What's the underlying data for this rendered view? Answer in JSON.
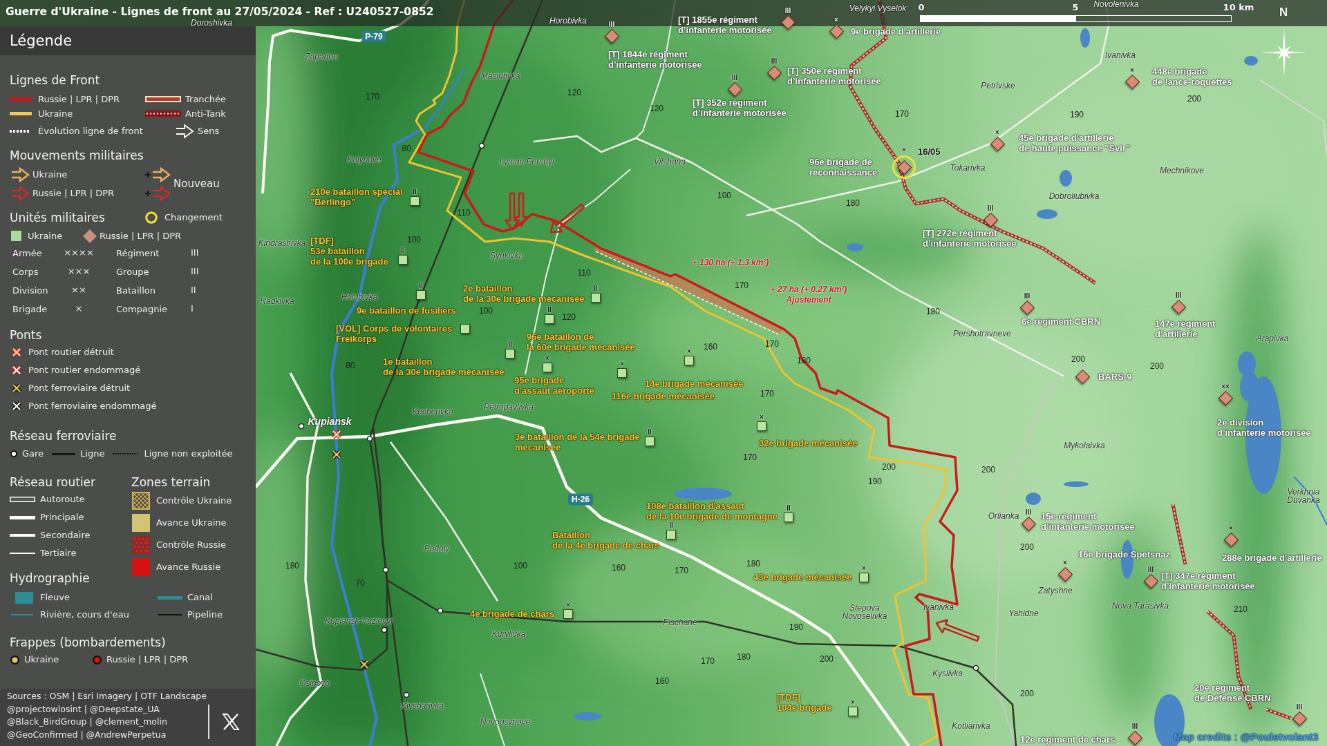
{
  "title": "Guerre d'Ukraine - Lignes de front au 27/05/2024 - Ref : U240527-0852",
  "scale_bar": {
    "labels": [
      "0",
      "5",
      "10 km"
    ]
  },
  "north_label": "N",
  "legend": {
    "title": "Légende",
    "front_lines": {
      "heading": "Lignes de Front",
      "items": [
        {
          "kind": "russia",
          "label": "Russie | LPR | DPR"
        },
        {
          "kind": "ukraine",
          "label": "Ukraine"
        },
        {
          "kind": "evolution",
          "label": "Évolution ligne de front"
        },
        {
          "kind": "trench",
          "label": "Tranchée"
        },
        {
          "kind": "antitank",
          "label": "Anti-Tank"
        },
        {
          "kind": "direction",
          "label": "Sens"
        }
      ]
    },
    "movements": {
      "heading": "Mouvements militaires",
      "items": [
        {
          "kind": "ukraine",
          "label": "Ukraine"
        },
        {
          "kind": "russia",
          "label": "Russie | LPR | DPR"
        }
      ],
      "new_label": "Nouveau"
    },
    "units": {
      "heading": "Unités militaires",
      "change_label": "Changement",
      "sides": [
        {
          "kind": "ukraine",
          "label": "Ukraine"
        },
        {
          "kind": "russia",
          "label": "Russie | LPR | DPR"
        }
      ],
      "echelons": [
        {
          "name": "Armée",
          "symbol": "××××"
        },
        {
          "name": "Corps",
          "symbol": "×××"
        },
        {
          "name": "Division",
          "symbol": "××"
        },
        {
          "name": "Brigade",
          "symbol": "×"
        },
        {
          "name": "Régiment",
          "symbol": "III"
        },
        {
          "name": "Groupe",
          "symbol": "III"
        },
        {
          "name": "Bataillon",
          "symbol": "II"
        },
        {
          "name": "Compagnie",
          "symbol": "I"
        }
      ]
    },
    "bridges": {
      "heading": "Ponts",
      "items": [
        {
          "kind": "road_destroyed",
          "label": "Pont routier détruit"
        },
        {
          "kind": "road_damaged",
          "label": "Pont routier endommagé"
        },
        {
          "kind": "rail_destroyed",
          "label": "Pont ferroviaire détruit"
        },
        {
          "kind": "rail_damaged",
          "label": "Pont ferroviaire endommagé"
        }
      ]
    },
    "railway": {
      "heading": "Réseau ferroviaire",
      "items": [
        {
          "kind": "station",
          "label": "Gare"
        },
        {
          "kind": "line",
          "label": "Ligne"
        },
        {
          "kind": "unused",
          "label": "Ligne non exploitée"
        }
      ]
    },
    "roads": {
      "heading": "Réseau routier",
      "items": [
        {
          "kind": "motorway",
          "label": "Autoroute"
        },
        {
          "kind": "primary",
          "label": "Principale"
        },
        {
          "kind": "secondary",
          "label": "Secondaire"
        },
        {
          "kind": "tertiary",
          "label": "Tertiaire"
        }
      ]
    },
    "terrain": {
      "heading": "Zones terrain",
      "items": [
        {
          "kind": "ukraine_control",
          "label": "Contrôle Ukraine"
        },
        {
          "kind": "ukraine_advance",
          "label": "Avance Ukraine"
        },
        {
          "kind": "russia_control",
          "label": "Contrôle Russie"
        },
        {
          "kind": "russia_advance",
          "label": "Avance Russie"
        }
      ]
    },
    "hydrography": {
      "heading": "Hydrographie",
      "items": [
        {
          "kind": "river",
          "label": "Fleuve"
        },
        {
          "kind": "canal",
          "label": "Canal"
        },
        {
          "kind": "stream",
          "label": "Rivière, cours d'eau"
        },
        {
          "kind": "pipeline",
          "label": "Pipeline"
        }
      ]
    },
    "strikes": {
      "heading": "Frappes (bombardements)",
      "items": [
        {
          "kind": "ukraine",
          "label": "Ukraine"
        },
        {
          "kind": "russia",
          "label": "Russie | LPR | DPR"
        }
      ]
    },
    "sources": "Sources : OSM | Esri Imagery | OTF Landscape",
    "contributors": [
      "@projectowlosint | @Deepstate_UA",
      "@Black_BirdGroup | @clement_molin",
      "@GeoConfirmed | @AndrewPerpetua"
    ]
  },
  "map": {
    "road_numbers": [
      "P-79",
      "H-26"
    ],
    "places": [
      {
        "name": "Velykyi Vyselok",
        "kind": "village"
      },
      {
        "name": "Novolenivka",
        "kind": "village"
      },
      {
        "name": "Doroshivka",
        "kind": "village"
      },
      {
        "name": "Horobivka",
        "kind": "village"
      },
      {
        "name": "Zapadne",
        "kind": "village"
      },
      {
        "name": "Ivanivka",
        "kind": "village"
      },
      {
        "name": "Masiutivka",
        "kind": "village"
      },
      {
        "name": "Petrivske",
        "kind": "village"
      },
      {
        "name": "Kalynove",
        "kind": "village"
      },
      {
        "name": "Lyman Pershyi",
        "kind": "village"
      },
      {
        "name": "Vilshana",
        "kind": "village"
      },
      {
        "name": "Tokarivka",
        "kind": "village"
      },
      {
        "name": "Mechnikove",
        "kind": "village"
      },
      {
        "name": "Dobroliubivka",
        "kind": "village"
      },
      {
        "name": "Kindrashivka",
        "kind": "village"
      },
      {
        "name": "Synkivka",
        "kind": "village"
      },
      {
        "name": "Radkivka",
        "kind": "village"
      },
      {
        "name": "Holubivka",
        "kind": "village"
      },
      {
        "name": "Pershotravneve",
        "kind": "village"
      },
      {
        "name": "Arapivka",
        "kind": "village"
      },
      {
        "name": "Kucherivka",
        "kind": "village"
      },
      {
        "name": "Petropavlivka",
        "kind": "village"
      },
      {
        "name": "Kupiansk",
        "kind": "city"
      },
      {
        "name": "Mykolaivka",
        "kind": "village"
      },
      {
        "lines": [
          "Verkhnia",
          "Duvanka"
        ],
        "kind": "village"
      },
      {
        "name": "Orlianka",
        "kind": "village"
      },
      {
        "name": "Podoly",
        "kind": "village"
      },
      {
        "name": "Zatyshne",
        "kind": "village"
      },
      {
        "name": "Kupiansk-Vuzlovyi",
        "kind": "village"
      },
      {
        "name": "Pischane",
        "kind": "village"
      },
      {
        "lines": [
          "Stepova",
          "Novoselivka"
        ],
        "kind": "village"
      },
      {
        "name": "Ivanivka",
        "kind": "village"
      },
      {
        "name": "Yahidne",
        "kind": "village"
      },
      {
        "name": "Nova Tarasivka",
        "kind": "village"
      },
      {
        "name": "Kurylivka",
        "kind": "village"
      },
      {
        "name": "Kyslivka",
        "kind": "village"
      },
      {
        "name": "Osinovo",
        "kind": "village"
      },
      {
        "name": "Kivsharivka",
        "kind": "village"
      },
      {
        "name": "Novoosynove",
        "kind": "village"
      },
      {
        "name": "Kotliarivka",
        "kind": "village"
      }
    ],
    "elevations": [
      "170",
      "120",
      "200",
      "120",
      "170",
      "190",
      "80",
      "100",
      "180",
      "110",
      "100",
      "110",
      "170",
      "100",
      "120",
      "180",
      "160",
      "170",
      "80",
      "180",
      "200",
      "200",
      "170",
      "170",
      "200",
      "200",
      "190",
      "200",
      "180",
      "100",
      "160",
      "170",
      "180",
      "70",
      "210",
      "190",
      "170",
      "180",
      "200",
      "160",
      "200"
    ],
    "units": [
      {
        "kind": "russia",
        "echelon": "III",
        "lines": [
          "[T] 1855e régiment",
          "d’infanterie motorisée"
        ],
        "changed": false
      },
      {
        "kind": "russia",
        "echelon": "×",
        "lines": [
          "9e brigade d'artillerie"
        ],
        "changed": false
      },
      {
        "kind": "russia",
        "echelon": "III",
        "lines": [
          "[T] 1844e régiment",
          "d’infanterie motorisée"
        ],
        "changed": false
      },
      {
        "kind": "russia",
        "echelon": "III",
        "lines": [
          "[T] 350e régiment",
          "d’infanterie motorisée"
        ],
        "changed": false
      },
      {
        "kind": "russia",
        "echelon": "×",
        "lines": [
          "448e brigade",
          "de lance-roquettes"
        ],
        "changed": false
      },
      {
        "kind": "russia",
        "echelon": "III",
        "lines": [
          "[T] 352e régiment",
          "d’infanterie motorisée"
        ],
        "changed": false
      },
      {
        "kind": "russia",
        "echelon": "×",
        "lines": [
          "45e brigade d'artillerie",
          "de haute puissance \"Svir\""
        ],
        "changed": false
      },
      {
        "kind": "russia",
        "echelon": "×",
        "lines": [
          "96e brigade de",
          "reconnaissance"
        ],
        "changed": true,
        "date": "16/05"
      },
      {
        "kind": "ukraine",
        "echelon": "II",
        "lines": [
          "210e bataillon spécial",
          "\"Berlingo\""
        ],
        "changed": false
      },
      {
        "kind": "ukraine",
        "echelon": "II",
        "lines": [
          "[TDF]",
          "53e bataillon",
          "de la 100e brigade"
        ],
        "changed": false
      },
      {
        "kind": "russia",
        "echelon": "III",
        "lines": [
          "[T] 272e régiment",
          "d’infanterie motorisée"
        ],
        "changed": false
      },
      {
        "kind": "ukraine",
        "echelon": "II",
        "lines": [
          "9e bataillon de fusiliers"
        ],
        "changed": false
      },
      {
        "kind": "ukraine",
        "echelon": "II",
        "lines": [
          "2e bataillon",
          "de la 30e brigade mécanisée"
        ],
        "changed": false
      },
      {
        "kind": "ukraine",
        "lines": [
          "[VOL] Corps de volontaires",
          "Freikorps"
        ],
        "changed": false
      },
      {
        "kind": "ukraine",
        "echelon": "II",
        "lines": [
          "96e bataillon de",
          "la 60e brigade mécanisée"
        ],
        "changed": false
      },
      {
        "kind": "russia",
        "echelon": "III",
        "lines": [
          "6e régiment CBRN"
        ],
        "changed": false
      },
      {
        "kind": "russia",
        "echelon": "III",
        "lines": [
          "147e régiment",
          "d'artillerie"
        ],
        "changed": false
      },
      {
        "kind": "ukraine",
        "echelon": "II",
        "lines": [
          "1e bataillon",
          "de la 30e brigade mécanisée"
        ],
        "changed": false
      },
      {
        "kind": "ukraine",
        "echelon": "×",
        "lines": [
          "95e brigade",
          "d'assaut aéroporté"
        ],
        "changed": false
      },
      {
        "kind": "ukraine",
        "echelon": "×",
        "lines": [
          "14e brigade mécanisée"
        ],
        "changed": false
      },
      {
        "kind": "russia",
        "lines": [
          "BARS-9"
        ],
        "changed": false
      },
      {
        "kind": "ukraine",
        "echelon": "×",
        "lines": [
          "116e brigade mécanisée"
        ],
        "changed": false
      },
      {
        "kind": "ukraine",
        "echelon": "II",
        "lines": [
          "3e bataillon de la 54e brigade",
          "mécanisée"
        ],
        "changed": false
      },
      {
        "kind": "ukraine",
        "echelon": "×",
        "lines": [
          "32e brigade mécanisée"
        ],
        "changed": false
      },
      {
        "kind": "russia",
        "echelon": "××",
        "lines": [
          "2e division",
          "d’infanterie motorisée"
        ],
        "changed": false
      },
      {
        "kind": "ukraine",
        "echelon": "II",
        "lines": [
          "108e bataillon d'assaut",
          "de la 10e brigade de montagne"
        ],
        "changed": false
      },
      {
        "kind": "ukraine",
        "echelon": "II",
        "lines": [
          "Bataillon",
          "de la 4e brigade de chars"
        ],
        "changed": false
      },
      {
        "kind": "russia",
        "echelon": "III",
        "lines": [
          "15e régiment",
          "d’infanterie motorisée"
        ],
        "changed": false
      },
      {
        "kind": "russia",
        "echelon": "×",
        "lines": [
          "16e brigade Spetsnaz"
        ],
        "changed": false
      },
      {
        "kind": "russia",
        "echelon": "×",
        "lines": [
          "288e brigade d'artillerie"
        ],
        "changed": false
      },
      {
        "kind": "ukraine",
        "echelon": "×",
        "lines": [
          "43e brigade mécanisée"
        ],
        "changed": false
      },
      {
        "kind": "russia",
        "echelon": "III",
        "lines": [
          "[T] 347e régiment",
          "d’infanterie motorisée"
        ],
        "changed": false
      },
      {
        "kind": "ukraine",
        "echelon": "×",
        "lines": [
          "4e brigade de chars"
        ],
        "changed": false
      },
      {
        "kind": "ukraine",
        "echelon": "×",
        "lines": [
          "[TDF]",
          "104e brigade"
        ],
        "changed": false
      },
      {
        "kind": "russia",
        "echelon": "III",
        "lines": [
          "20e régiment",
          "de Défense CBRN"
        ],
        "changed": false
      },
      {
        "kind": "russia",
        "echelon": "III",
        "lines": [
          "12e régiment de chars"
        ],
        "changed": false
      }
    ],
    "area_notes": [
      {
        "lines": [
          "+ 130 ha (+ 1.3 km²)"
        ]
      },
      {
        "lines": [
          "+ 27 ha (+ 0.27 km²)",
          "Ajustement"
        ]
      }
    ],
    "credits": "Map credits : @Pouletvolant3"
  }
}
